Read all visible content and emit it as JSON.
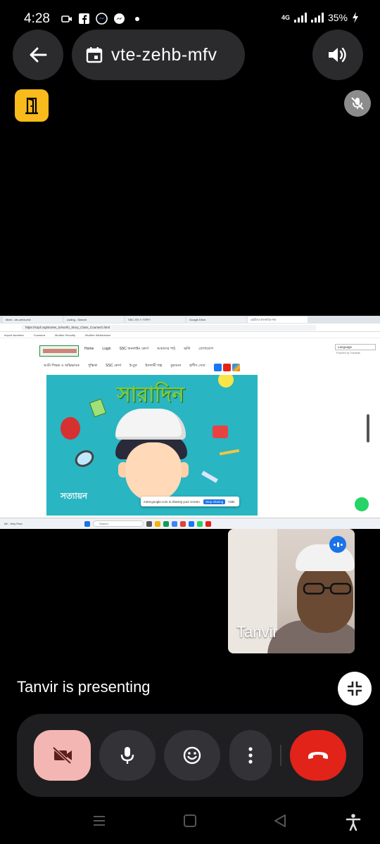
{
  "status_bar": {
    "time": "4:28",
    "network": "4G",
    "battery": "35%",
    "icons": [
      "video-camera-icon",
      "facebook-icon",
      "messenger-icon",
      "messenger-icon",
      "dot-icon"
    ]
  },
  "top": {
    "meeting_code": "vte-zehb-mfv",
    "back_icon": "back-arrow-icon",
    "speaker_icon": "speaker-icon",
    "breakout_icon": "door-icon",
    "muted_icon": "mic-off-icon"
  },
  "shared_screen": {
    "tabs": [
      "Meet - vte-zehb-mfv",
      "coding - Search",
      "SSC প্রশ্ন ও সমাধান",
      "Google Drive",
      "ছোটদের ইসলামিক গল্প"
    ],
    "url": "https://sopf.org/stories_to/sorifo_Story_Class_Course/1.html",
    "bookmarks": [
      "Import favorites",
      "Coursera",
      "McAfee Security",
      "McAfee WebAdvisor"
    ],
    "nav_row_1": [
      "Home",
      "Login",
      "SSC অনলাইন কোর্স",
      "আমাদের পাঠ",
      "ভর্তি",
      "যোগাযোগ"
    ],
    "nav_row_2": [
      "আমি শিক্ষক ও অভিভাবক",
      "পুস্তিকা",
      "SSC কোর্স",
      "ই-বুক",
      "ইসলামী গল্প",
      "কুরআন",
      "হাদীস সেবা"
    ],
    "language": "Language",
    "translate_label": "Powered by Translate",
    "poster_title": "সারাদিন",
    "poster_logo": "সত্যায়ন",
    "share_notice": "meet.google.com is sharing your screen.",
    "stop_sharing": "Stop sharing",
    "hide": "Hide",
    "taskbar_search": "Search",
    "weather": "Alt - Very Poor"
  },
  "participant": {
    "name": "Tanvir",
    "speaking": true
  },
  "presenting_text": "Tanvir is presenting",
  "controls": {
    "camera": "camera-off-icon",
    "mic": "mic-icon",
    "reactions": "emoji-icon",
    "more": "more-vertical-icon",
    "hangup": "hang-up-icon"
  },
  "colors": {
    "camera_off_bg": "#f4b6b3",
    "hangup_bg": "#e2231a",
    "breakout_bg": "#f9ba1c",
    "speaking_badge": "#1a73e8"
  }
}
